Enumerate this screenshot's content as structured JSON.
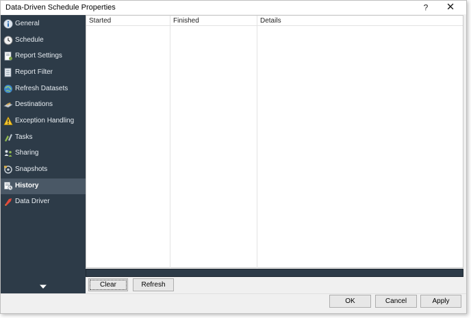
{
  "window": {
    "title": "Data-Driven Schedule Properties",
    "help_label": "?",
    "close_label": "✕"
  },
  "sidebar": {
    "items": [
      {
        "label": "General",
        "icon": "info-icon"
      },
      {
        "label": "Schedule",
        "icon": "clock-icon"
      },
      {
        "label": "Report Settings",
        "icon": "report-settings-icon"
      },
      {
        "label": "Report Filter",
        "icon": "report-filter-icon"
      },
      {
        "label": "Refresh Datasets",
        "icon": "refresh-globe-icon"
      },
      {
        "label": "Destinations",
        "icon": "destinations-icon"
      },
      {
        "label": "Exception Handling",
        "icon": "warning-icon"
      },
      {
        "label": "Tasks",
        "icon": "tasks-icon"
      },
      {
        "label": "Sharing",
        "icon": "sharing-icon"
      },
      {
        "label": "Snapshots",
        "icon": "snapshots-icon"
      },
      {
        "label": "History",
        "icon": "history-icon",
        "active": true
      },
      {
        "label": "Data Driver",
        "icon": "data-driver-icon"
      }
    ]
  },
  "grid": {
    "columns": [
      "Started",
      "Finished",
      "Details"
    ]
  },
  "actions": {
    "clear_label": "Clear",
    "refresh_label": "Refresh"
  },
  "footer": {
    "ok_label": "OK",
    "cancel_label": "Cancel",
    "apply_label": "Apply"
  },
  "colors": {
    "sidebar_bg": "#2d3b48",
    "sidebar_active": "#4a5866",
    "window_bg": "#f0f0f0"
  }
}
